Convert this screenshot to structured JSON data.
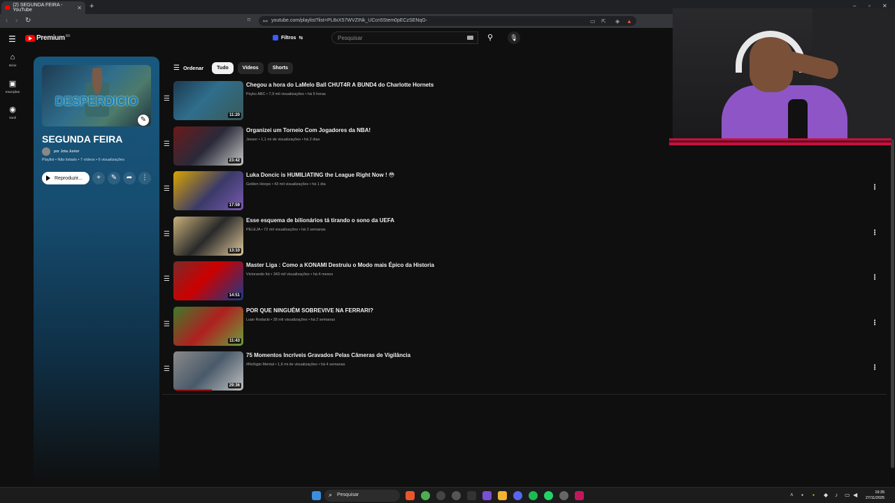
{
  "browser": {
    "tab_title": "(2) SEGUNDA FEIRA - YouTube",
    "url": "youtube.com/playlist?list=PL8xX57WVZINk_UCcn5Stem0pECzSENqG-"
  },
  "header": {
    "logo_text": "Premium",
    "logo_region": "BR",
    "filters_label": "Filtros",
    "search_placeholder": "Pesquisar"
  },
  "nav": [
    {
      "label": "Início"
    },
    {
      "label": "Inscrições"
    },
    {
      "label": "Você"
    }
  ],
  "playlist": {
    "thumb_text": "DESPERDICIO",
    "title": "SEGUNDA FEIRA",
    "owner": "por Jota Junior",
    "meta": "Playlist • Não listado • 7 vídeos • 6 visualizações",
    "play_label": "Reproduzir..."
  },
  "chips": {
    "sort_label": "Ordenar",
    "items": [
      "Tudo",
      "Vídeos",
      "Shorts"
    ]
  },
  "videos": [
    {
      "title": "Chegou a hora do LaMelo Ball CHUT4R A BUND4 do Charlotte Hornets",
      "channel": "Psyko ABC",
      "views": "7,9 mil visualizações",
      "age": "há 5 horas",
      "duration": "11:20",
      "progress": 0
    },
    {
      "title": "Organizei um Torneio Com Jogadores da NBA!",
      "channel": "Jesser",
      "views": "1,1 mi de visualizações",
      "age": "há 2 dias",
      "duration": "23:42",
      "progress": 0
    },
    {
      "title": "Luka Doncic is HUMILIATING the League Right Now ! 😳",
      "channel": "Golden Hoops",
      "views": "43 mil visualizações",
      "age": "há 1 dia",
      "duration": "17:59",
      "progress": 0
    },
    {
      "title": "Esse esquema de bilionários tá tirando o sono da UEFA",
      "channel": "PELEJA",
      "views": "72 mil visualizações",
      "age": "há 2 semanas",
      "duration": "13:10",
      "progress": 0
    },
    {
      "title": "Master Liga : Como a KONAMI Destruiu o Modo mais Épico da Historia",
      "channel": "Victorando fut",
      "views": "343 mil visualizações",
      "age": "há 4 meses",
      "duration": "14:51",
      "progress": 0
    },
    {
      "title": "POR QUE NINGUÉM SOBREVIVE NA FERRARI?",
      "channel": "Luan Rodacki",
      "views": "28 mil visualizações",
      "age": "há 2 semanas",
      "duration": "11:43",
      "progress": 0
    },
    {
      "title": "75 Momentos Incríveis Gravados Pelas Câmeras de Vigilância",
      "channel": "#Refúgio Mental",
      "views": "1,6 mi de visualizações",
      "age": "há 4 semanas",
      "duration": "29:36",
      "progress": 0.55
    }
  ],
  "taskbar": {
    "search_label": "Pesquisar",
    "time": "19:35",
    "date": "27/11/2025"
  },
  "colors": {
    "accent": "#ff0000",
    "playlist_panel": "#19587e",
    "background": "#0f0f0f"
  }
}
